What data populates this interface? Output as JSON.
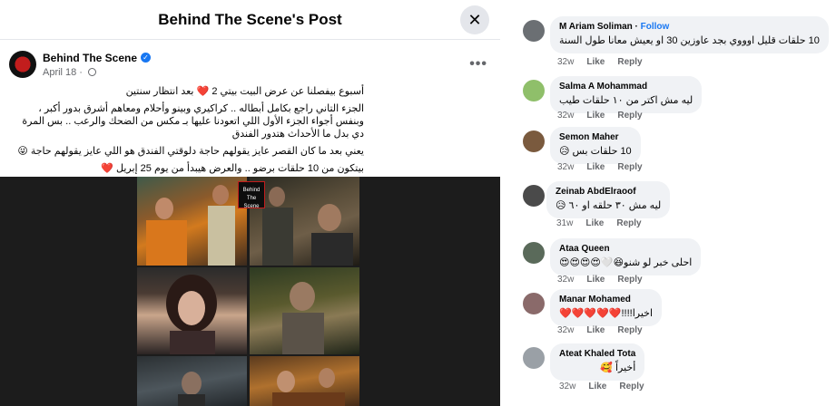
{
  "post": {
    "dialog_title": "Behind The Scene's Post",
    "close_icon": "close-icon",
    "author": "Behind The Scene",
    "date": "April 18",
    "more_label": "•••",
    "text_lines": [
      "أسبوع بيفصلنا عن عرض البيت بيتي 2 ❤️ بعد انتظار سنتين",
      "الجزء التاني راجع بكامل أبطاله .. كراكيري وبينو وأحلام ومعاهم أشرق بدور أكبر ، وبنفس أجواء الجزء الأول اللي اتعودنا عليها بـ مكس من الضحك والرعب .. بس المرة دي بدل ما الأحداث هتدور الفندق",
      "يعني بعد ما كان القصر عايز يقولهم حاجة دلوقتي الفندق هو اللي عايز يقولهم حاجة 😜",
      "بيتكون من 10 حلقات برضو .. والعرض هيبدأ من يوم 25 إبريل ❤️"
    ],
    "logo_text": "Behind The Scene"
  },
  "comments": [
    {
      "name": "M Ariam Soliman",
      "follow": "Follow",
      "text": "10 حلقات قليل اوووي بجد عاوزين 30 او يعيش معانا طول السنة",
      "age": "32w",
      "like": "Like",
      "reply": "Reply",
      "avatar_color": "#6b6f73"
    },
    {
      "name": "Salma A Mohammad",
      "follow": "",
      "text": "ليه مش اكتر من ١٠ حلقات طيب",
      "age": "32w",
      "like": "Like",
      "reply": "Reply",
      "avatar_color": "#8fbf6a"
    },
    {
      "name": "Semon Maher",
      "follow": "",
      "text": "10 حلقات بس 😥",
      "age": "32w",
      "like": "Like",
      "reply": "Reply",
      "avatar_color": "#7a5a3e"
    },
    {
      "name": "Zeinab AbdElraoof",
      "follow": "",
      "text": "ليه مش ٣٠ حلقه او ٦٠ 😥",
      "age": "31w",
      "like": "Like",
      "reply": "Reply",
      "avatar_color": "#4a4a4a"
    },
    {
      "name": "Ataa Queen",
      "follow": "",
      "text": "احلى خبر لو شنو😆🤍😍😍😍😍",
      "age": "32w",
      "like": "Like",
      "reply": "Reply",
      "avatar_color": "#5a6a5a"
    },
    {
      "name": "Manar Mohamed",
      "follow": "",
      "text": "اخيرا!!!!❤️❤️❤️❤️❤️",
      "age": "32w",
      "like": "Like",
      "reply": "Reply",
      "avatar_color": "#8a6a6a"
    },
    {
      "name": "Ateat Khaled Tota",
      "follow": "",
      "text": "أخيراً 🥰",
      "age": "32w",
      "like": "Like",
      "reply": "Reply",
      "avatar_color": "#9aa0a6"
    }
  ],
  "colors": {
    "accent": "#1877f2",
    "bubble": "#f0f2f5",
    "muted": "#65676b"
  }
}
